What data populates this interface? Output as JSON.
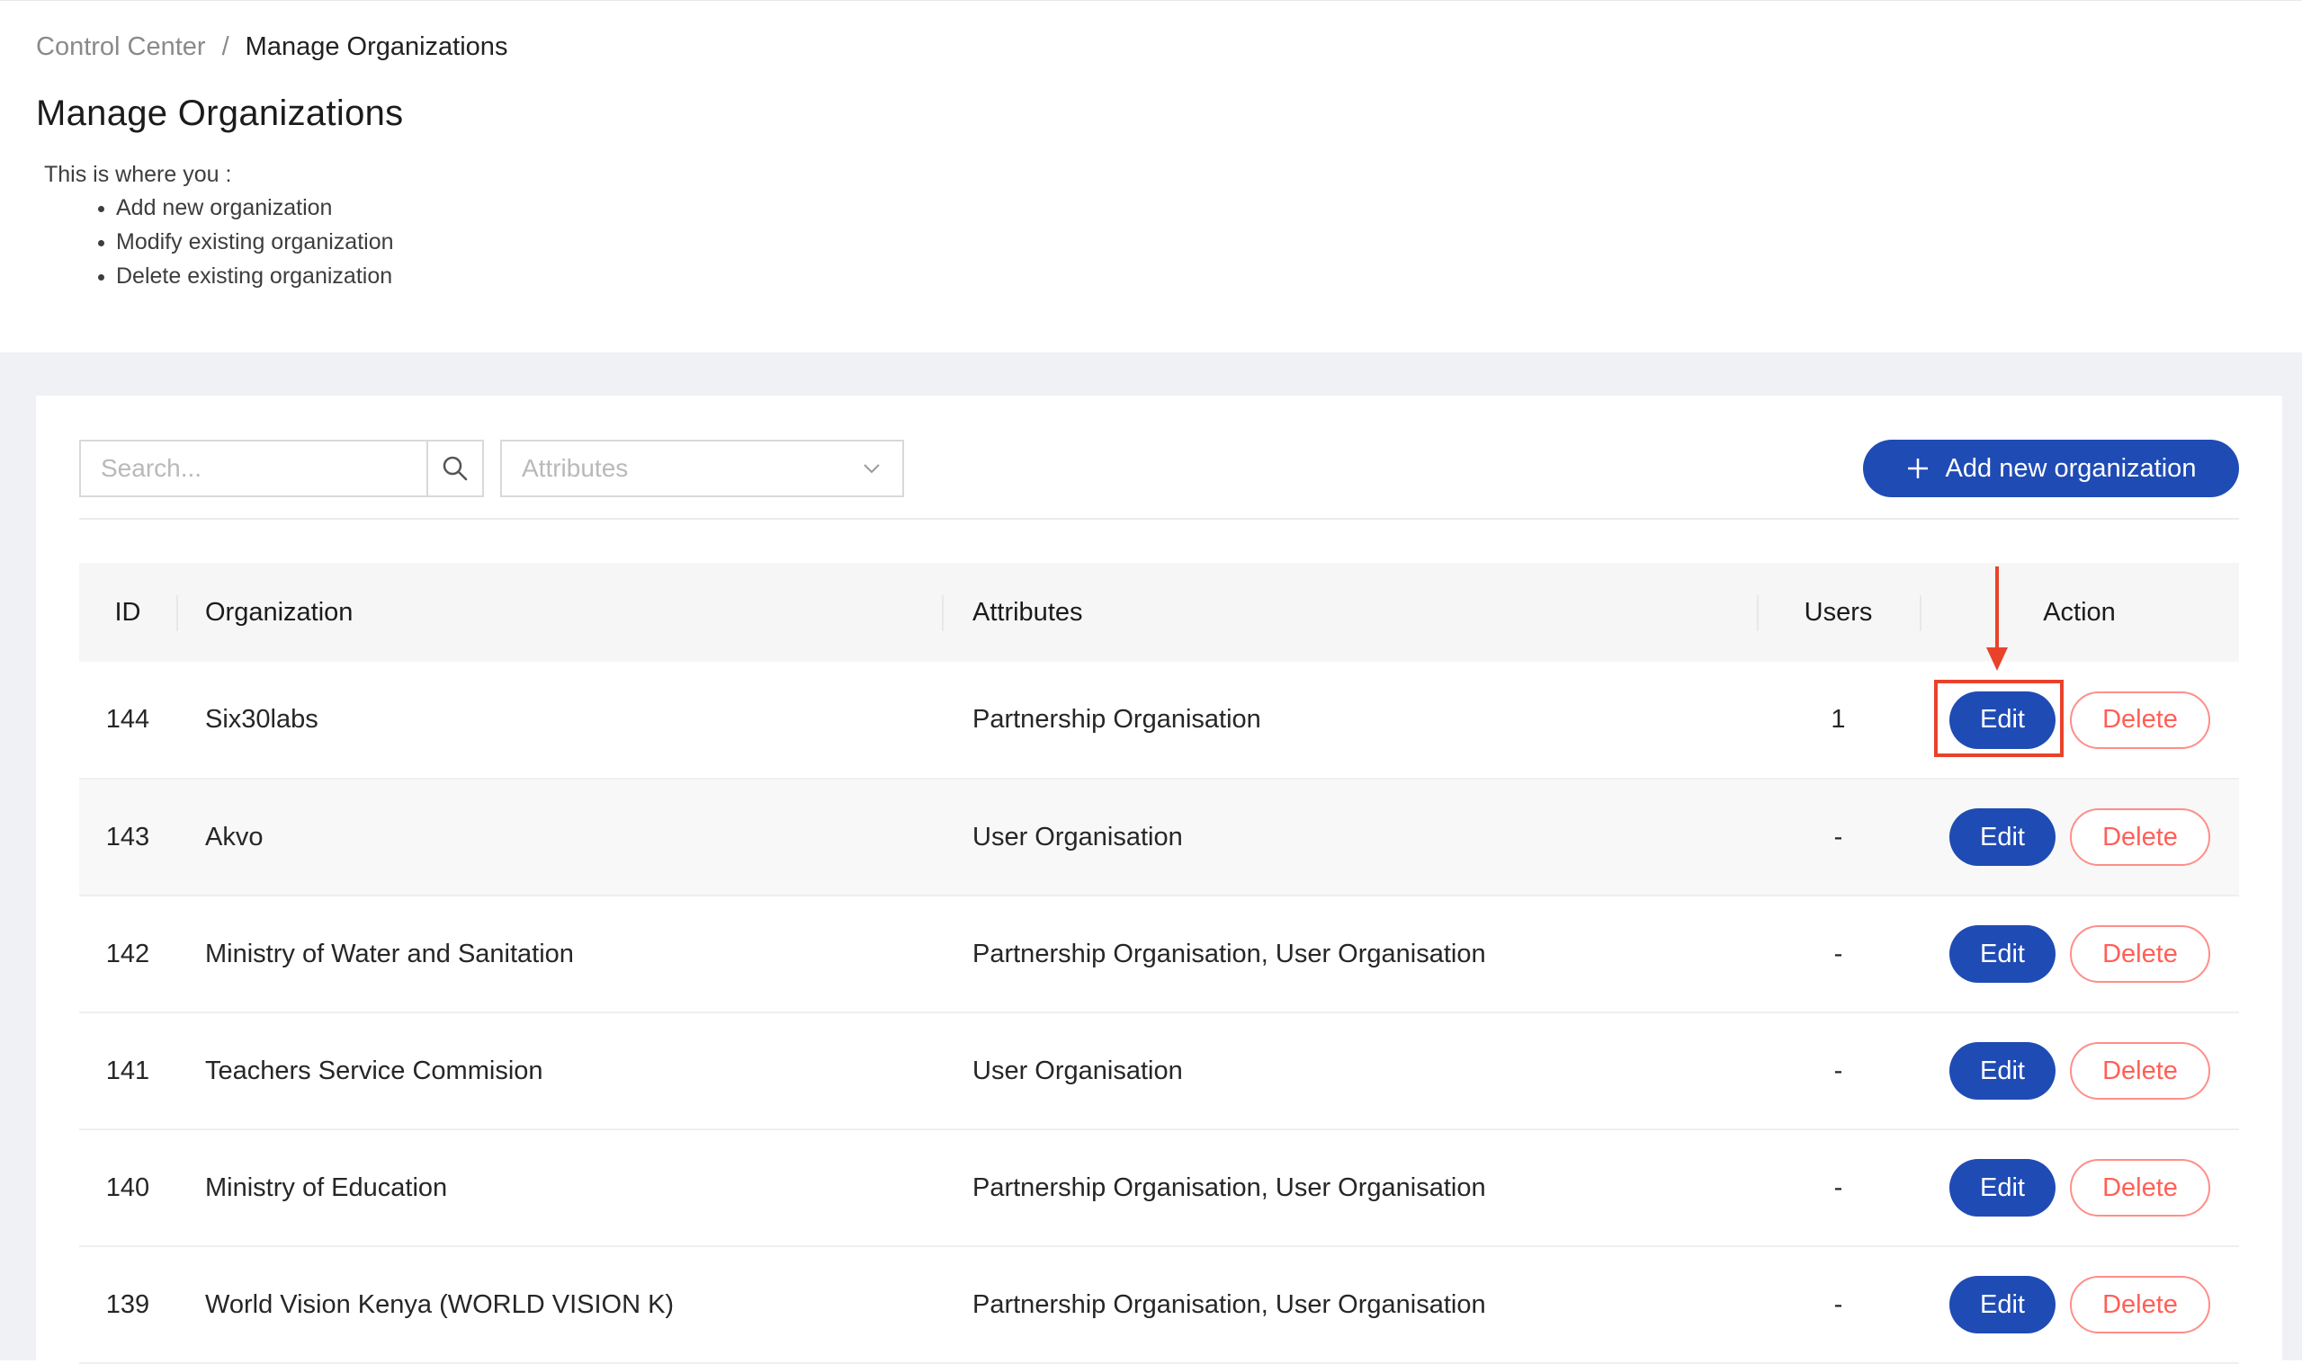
{
  "breadcrumb": {
    "home": "Control Center",
    "separator": "/",
    "current": "Manage Organizations"
  },
  "page": {
    "title": "Manage Organizations",
    "intro": "This is where you :",
    "bullets": [
      "Add new organization",
      "Modify existing organization",
      "Delete existing organization"
    ]
  },
  "toolbar": {
    "search_placeholder": "Search...",
    "attributes_placeholder": "Attributes",
    "add_label": "Add new organization"
  },
  "table": {
    "headers": {
      "id": "ID",
      "organization": "Organization",
      "attributes": "Attributes",
      "users": "Users",
      "action": "Action"
    },
    "edit_label": "Edit",
    "delete_label": "Delete",
    "rows": [
      {
        "id": "144",
        "organization": "Six30labs",
        "attributes": "Partnership Organisation",
        "users": "1"
      },
      {
        "id": "143",
        "organization": "Akvo",
        "attributes": "User Organisation",
        "users": "-"
      },
      {
        "id": "142",
        "organization": "Ministry of Water and Sanitation",
        "attributes": "Partnership Organisation, User Organisation",
        "users": "-"
      },
      {
        "id": "141",
        "organization": "Teachers Service Commision",
        "attributes": "User Organisation",
        "users": "-"
      },
      {
        "id": "140",
        "organization": "Ministry of Education",
        "attributes": "Partnership Organisation, User Organisation",
        "users": "-"
      },
      {
        "id": "139",
        "organization": "World Vision Kenya (WORLD VISION K)",
        "attributes": "Partnership Organisation, User Organisation",
        "users": "-"
      }
    ]
  },
  "colors": {
    "primary": "#1f4bb4",
    "danger": "#ff5f56",
    "annotation": "#e8432a",
    "content_bg": "#f0f1f4"
  },
  "icons": {
    "search": "search-icon",
    "dropdown": "chevron-down-icon",
    "add": "plus-icon",
    "annotation": "down-arrow-annotation"
  }
}
